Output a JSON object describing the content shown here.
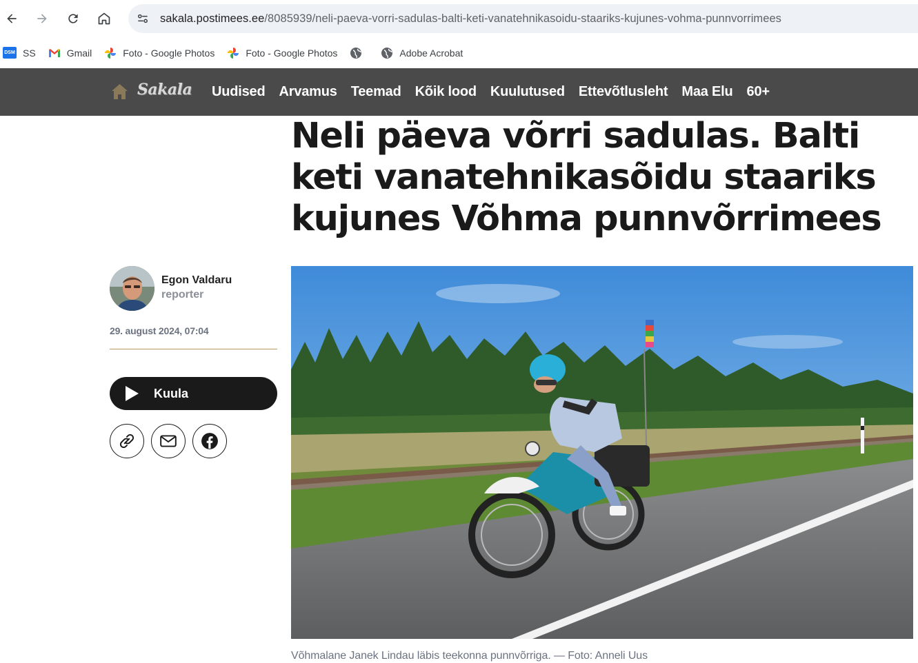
{
  "browser": {
    "url_domain": "sakala.postimees.ee",
    "url_path": "/8085939/neli-paeva-vorri-sadulas-balti-keti-vanatehnikasoidu-staariks-kujunes-vohma-punnvorrimees",
    "bookmarks": [
      {
        "label": "SS",
        "icon": "dsm-icon"
      },
      {
        "label": "Gmail",
        "icon": "gmail-icon"
      },
      {
        "label": "Foto - Google Photos",
        "icon": "google-photos-icon"
      },
      {
        "label": "Foto - Google Photos",
        "icon": "google-photos-icon"
      },
      {
        "label": "",
        "icon": "globe-icon"
      },
      {
        "label": "Adobe Acrobat",
        "icon": "globe-icon"
      }
    ],
    "dsm_badge": "DSM"
  },
  "site": {
    "logo_text": "Sakala",
    "nav": [
      "Uudised",
      "Arvamus",
      "Teemad",
      "Kõik lood",
      "Kuulutused",
      "Ettevõtlusleht",
      "Maa Elu",
      "60+"
    ],
    "header_bg": "#4a4a4a"
  },
  "article": {
    "headline": "Neli päeva võrri sadulas. Balti keti vanatehnikasõidu staariks kujunes Võhma punnvõrrimees",
    "author_name": "Egon Valdaru",
    "author_role": "reporter",
    "date": "29. august 2024, 07:04",
    "listen_label": "Kuula",
    "share": [
      "link-icon",
      "mail-icon",
      "facebook-icon"
    ],
    "caption": "Võhmalane Janek Lindau läbis teekonna punnvõrriga. — Foto: Anneli Uus"
  }
}
